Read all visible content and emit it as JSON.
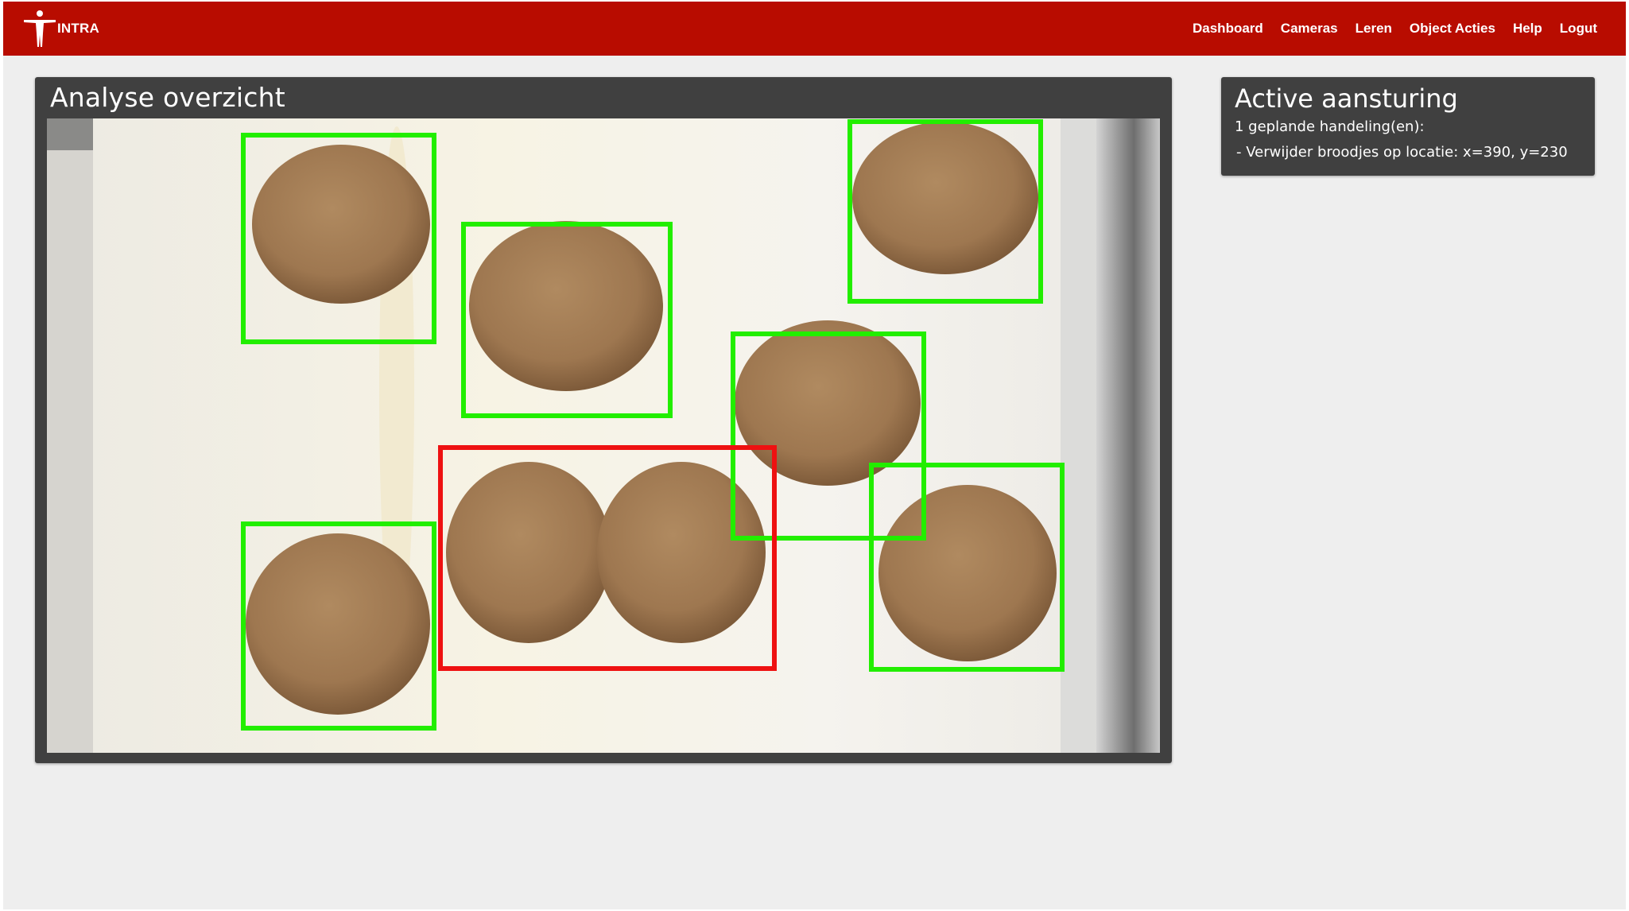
{
  "nav": {
    "brand": "INTRA",
    "links": [
      "Dashboard",
      "Cameras",
      "Leren",
      "Object Acties",
      "Help",
      "Logut"
    ]
  },
  "analyse": {
    "title": "Analyse overzicht"
  },
  "active": {
    "title": "Active aansturing",
    "count_text": "1 geplande handeling(en):",
    "action_text": "- Verwijder broodjes op locatie: x=390, y=230"
  },
  "colors": {
    "navbar": "#b80c00",
    "panel": "#404040",
    "detection_ok": "#22ee00",
    "detection_error": "#ee1111"
  }
}
